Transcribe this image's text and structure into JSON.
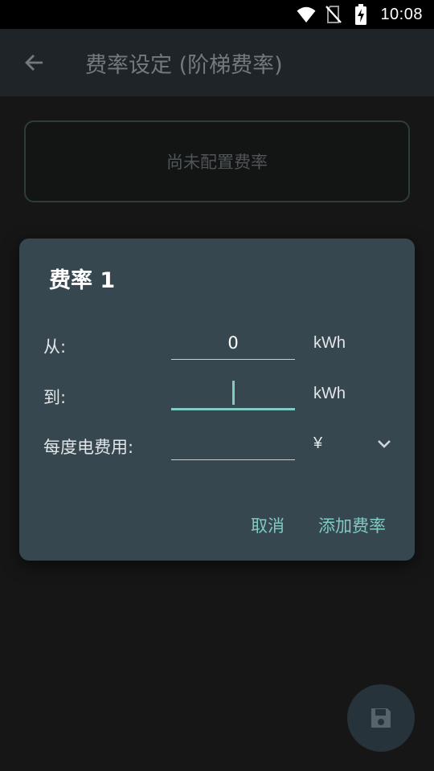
{
  "status_bar": {
    "time": "10:08",
    "icons": [
      "wifi-icon",
      "no-sim-icon",
      "battery-charging-icon"
    ]
  },
  "app_bar": {
    "back_icon": "arrow-back-icon",
    "title": "费率设定 (阶梯费率)"
  },
  "empty_state": {
    "message": "尚未配置费率"
  },
  "dialog": {
    "title": "费率 1",
    "fields": {
      "from": {
        "label": "从:",
        "value": "0",
        "unit": "kWh"
      },
      "to": {
        "label": "到:",
        "value": "",
        "unit": "kWh"
      },
      "cost": {
        "label": "每度电费用:",
        "value": "",
        "unit": "¥"
      }
    },
    "actions": {
      "cancel": "取消",
      "add": "添加费率"
    }
  },
  "fab": {
    "icon": "save-icon"
  },
  "colors": {
    "accent": "#80cbc4",
    "dialog_bg": "#37474f",
    "background": "#161616"
  }
}
